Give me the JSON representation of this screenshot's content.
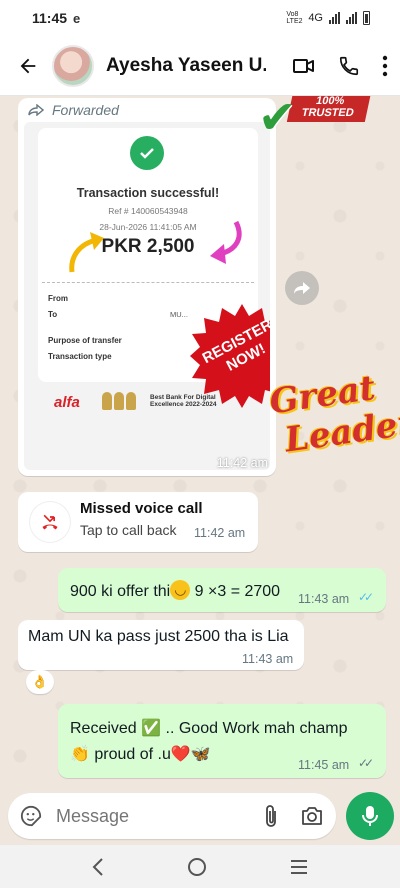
{
  "status_bar": {
    "time": "11:45",
    "app_glyph": "e",
    "network": "4G",
    "volte": "Vo8 LTE2"
  },
  "header": {
    "contact_name": "Ayesha Yaseen U..."
  },
  "forwarded_message": {
    "forwarded_label": "Forwarded",
    "time": "11:42 am",
    "receipt": {
      "title": "Transaction successful!",
      "ref": "Ref # 140060543948",
      "date": "28-Jun-2026 11:41:05 AM",
      "amount": "PKR 2,500",
      "rows": [
        {
          "label": "From",
          "value": ""
        },
        {
          "label": "To",
          "value": "MU..."
        },
        {
          "label": "Purpose of transfer",
          "value": ""
        },
        {
          "label": "Transaction type",
          "value": ""
        }
      ],
      "bank_logo": "alfa",
      "bank_award": "Best Bank For Digital Excellence 2022-2024"
    }
  },
  "stickers": {
    "trusted": "100% TRUSTED",
    "register": "REGISTER NOW!",
    "great_leader_line1": "Great",
    "great_leader_line2": "Leader"
  },
  "missed_call": {
    "title": "Missed voice call",
    "subtitle": "Tap to call back",
    "time": "11:42 am"
  },
  "messages": [
    {
      "direction": "out",
      "text_before": "900 ki offer thi",
      "text_after": " 9 ×3 = 2700",
      "time": "11:43 am",
      "status": "read"
    },
    {
      "direction": "in",
      "text": "Mam UN ka pass just 2500 tha is Lia",
      "time": "11:43 am",
      "reaction": "👌"
    },
    {
      "direction": "out",
      "line1": "Received ✅ .. Good Work mah champ",
      "line2": "👏 proud of .u❤️🦋",
      "time": "11:45 am",
      "status": "delivered"
    }
  ],
  "composer": {
    "placeholder": "Message"
  },
  "colors": {
    "accent": "#1daa61",
    "outgoing_bubble": "#d9fdd3",
    "chat_bg": "#efe7de",
    "read_tick": "#53bdeb"
  }
}
